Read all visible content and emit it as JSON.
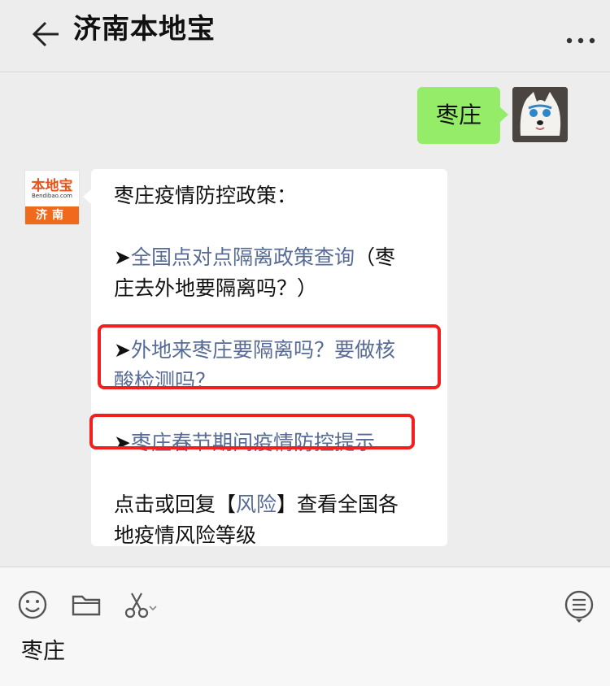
{
  "header": {
    "title": "济南本地宝"
  },
  "chat": {
    "user_message": "枣庄",
    "bot_logo": {
      "main": "本地宝",
      "sub": "Bendibao.com",
      "city": "济南"
    },
    "bot_message": {
      "line1": "枣庄疫情防控政策：",
      "arrow": "➤",
      "item1_link": "全国点对点隔离政策查询",
      "item1_text_a": "（枣",
      "item1_text_b": "庄去外地要隔离吗？）",
      "item2_link_a": "外地来枣庄要隔离吗？要做核",
      "item2_link_b": "酸检测吗？",
      "item3_link": "枣庄春节期间疫情防控提示",
      "footer_a": "点击或回复【",
      "footer_link": "风险",
      "footer_b": "】查看全国各",
      "footer_c": "地疫情风险等级"
    }
  },
  "input": {
    "value": "枣庄"
  },
  "colors": {
    "link": "#576b95",
    "user_bubble": "#95ec69",
    "highlight": "#f21f1f"
  }
}
